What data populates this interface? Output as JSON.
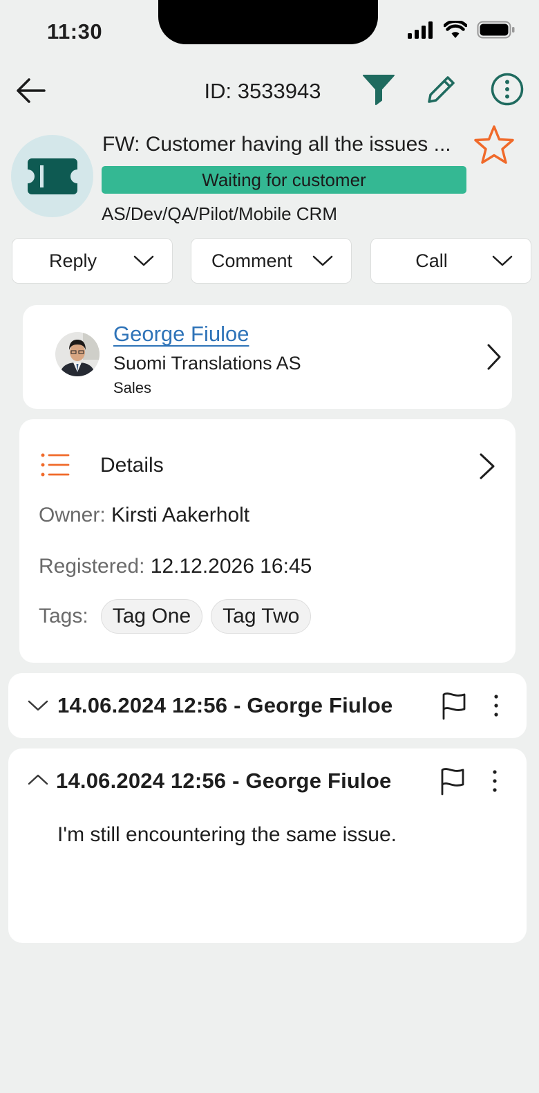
{
  "status_bar": {
    "time": "11:30"
  },
  "header": {
    "ticket_id": "ID: 3533943"
  },
  "ticket": {
    "title": "FW: Customer having all the issues ...",
    "status": "Waiting for customer",
    "category": "AS/Dev/QA/Pilot/Mobile CRM",
    "status_color": "#34b893"
  },
  "actions": [
    {
      "label": "Reply"
    },
    {
      "label": "Comment"
    },
    {
      "label": "Call"
    }
  ],
  "contact": {
    "name": "George Fiuloe",
    "company": "Suomi Translations AS",
    "department": "Sales"
  },
  "details": {
    "title": "Details",
    "owner_label": "Owner:",
    "owner": "Kirsti Aakerholt",
    "registered_label": "Registered:",
    "registered": "12.12.2026 16:45",
    "tags_label": "Tags:",
    "tags": [
      "Tag One",
      "Tag Two"
    ]
  },
  "comments": [
    {
      "title": "14.06.2024 12:56 - George Fiuloe",
      "expanded": false
    },
    {
      "title": "14.06.2024 12:56 - George Fiuloe",
      "expanded": true,
      "body": "I'm still encountering the same issue."
    }
  ],
  "colors": {
    "accent": "#1f6b5f",
    "star": "#f06a2a",
    "link": "#2e73b8"
  },
  "icons": [
    "back-arrow-icon",
    "filter-icon",
    "edit-pencil-icon",
    "more-options-icon",
    "ticket-icon",
    "star-icon",
    "chevron-down-icon",
    "chevron-right-icon",
    "list-icon",
    "flag-icon",
    "kebab-icon"
  ]
}
